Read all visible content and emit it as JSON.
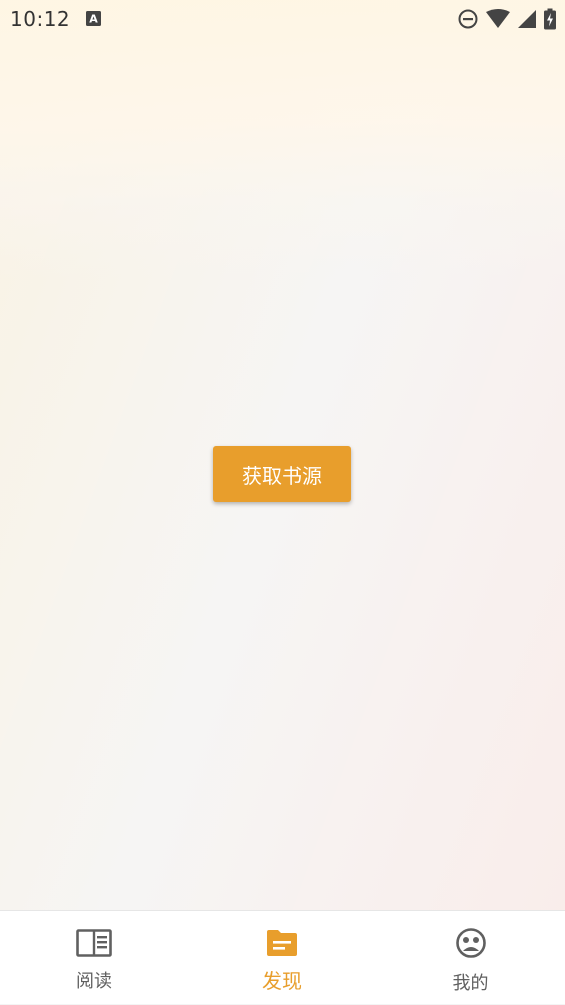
{
  "status_bar": {
    "time": "10:12",
    "a_icon": "text-a-icon",
    "icons": [
      "do-not-disturb-icon",
      "wifi-icon",
      "signal-icon",
      "battery-charging-icon"
    ]
  },
  "main": {
    "fetch_button_label": "获取书源"
  },
  "bottom_nav": {
    "items": [
      {
        "label": "阅读",
        "icon": "book-icon",
        "active": false
      },
      {
        "label": "发现",
        "icon": "folder-icon",
        "active": true
      },
      {
        "label": "我的",
        "icon": "face-icon",
        "active": false
      }
    ],
    "active_color": "#e89e2c",
    "inactive_color": "#606060"
  },
  "colors": {
    "accent": "#e89e2c",
    "background": "#f4f4f4"
  }
}
